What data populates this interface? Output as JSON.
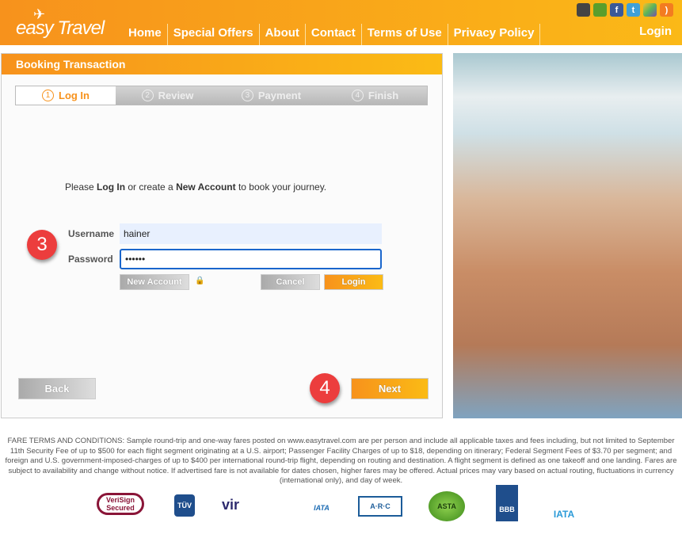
{
  "header": {
    "logo": "easy Travel",
    "nav": [
      "Home",
      "Special Offers",
      "About",
      "Contact",
      "Terms of Use",
      "Privacy Policy"
    ],
    "login": "Login",
    "social": [
      {
        "icon": "apple-icon",
        "color": "#444"
      },
      {
        "icon": "android-icon",
        "color": "#5a9e2c"
      },
      {
        "icon": "facebook-icon",
        "color": "#3b5998"
      },
      {
        "icon": "twitter-icon",
        "color": "#3fa0d8"
      },
      {
        "icon": "multicolor-icon",
        "color": "#7b4fa8"
      },
      {
        "icon": "rss-icon",
        "color": "#f37c20"
      }
    ]
  },
  "panel": {
    "title": "Booking Transaction",
    "steps": [
      {
        "n": "1",
        "label": "Log In"
      },
      {
        "n": "2",
        "label": "Review"
      },
      {
        "n": "3",
        "label": "Payment"
      },
      {
        "n": "4",
        "label": "Finish"
      }
    ],
    "intro": {
      "a": "Please ",
      "b": "Log In",
      "c": " or create a ",
      "d": "New Account",
      "e": " to book your journey."
    },
    "username_label": "Username",
    "username_value": "hainer",
    "password_label": "Password",
    "password_value": "••••••",
    "new_account": "New Account",
    "cancel": "Cancel",
    "login": "Login",
    "back": "Back",
    "next": "Next",
    "badge3": "3",
    "badge4": "4"
  },
  "terms": "FARE TERMS AND CONDITIONS: Sample round-trip and one-way fares posted on www.easytravel.com are per person and include all applicable taxes and fees including, but not limited to September 11th Security Fee of up to $500 for each flight segment originating at a U.S. airport; Passenger Facility Charges of up to $18, depending on itinerary; Federal Segment Fees of $3.70 per segment; and foreign and U.S. government-imposed-charges of up to $400 per international round-trip flight, depending on routing and destination. A flight segment is defined as one takeoff and one landing. Fares are subject to availability and change without notice. If advertised fare is not available for dates chosen, higher fares may be offered. Actual prices may vary based on actual routing, fluctuations in currency (international only), and day of week.",
  "logos": [
    "VeriSign Secured",
    "TÜV",
    "vir",
    "IATA",
    "A·R·C",
    "ASTA",
    "BBB",
    "IATA"
  ]
}
